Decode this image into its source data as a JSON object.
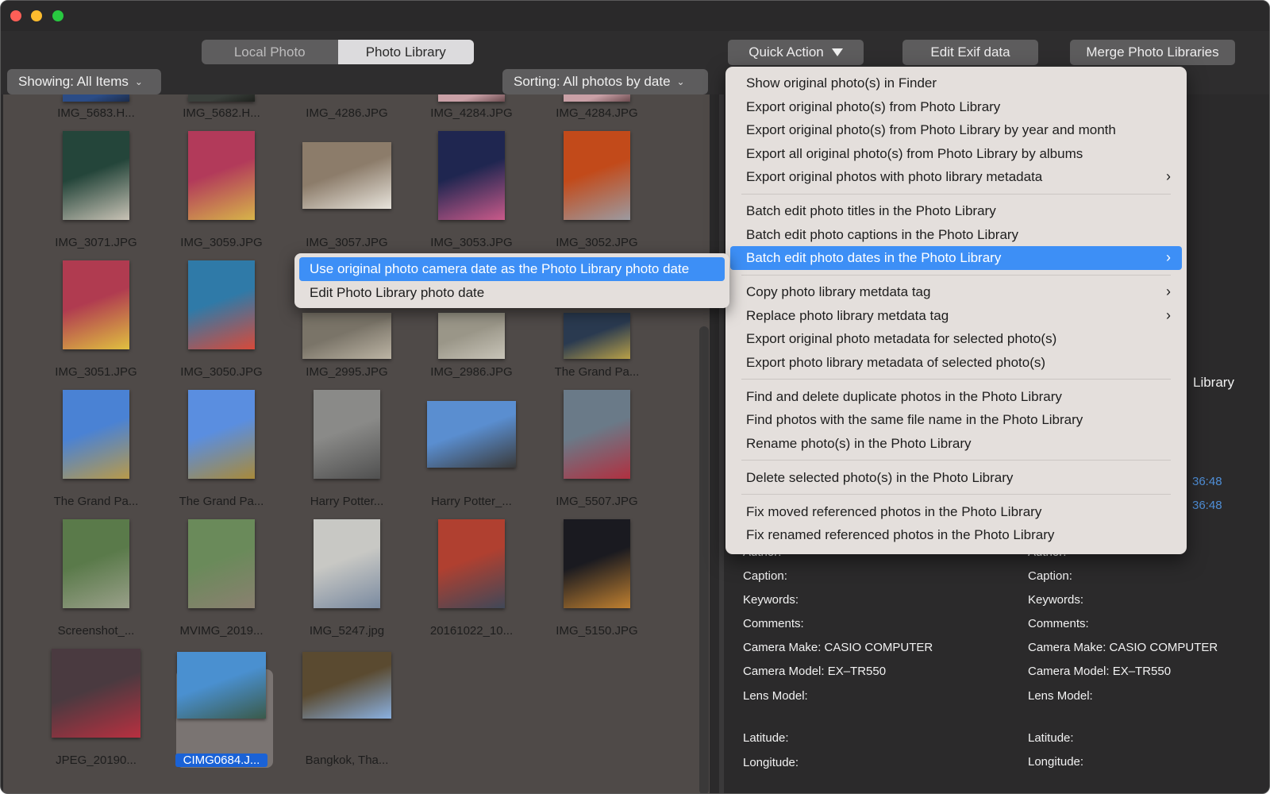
{
  "window": {
    "controls": [
      "close",
      "minimize",
      "zoom"
    ]
  },
  "toolbar": {
    "segments": [
      {
        "label": "Local Photo",
        "active": false
      },
      {
        "label": "Photo Library",
        "active": true
      }
    ],
    "quick_action_label": "Quick Action",
    "edit_exif_label": "Edit Exif data",
    "merge_label": "Merge Photo Libraries",
    "showing_label": "Showing: All Items",
    "sorting_label": "Sorting: All photos by date"
  },
  "photos": [
    {
      "name": "IMG_5683.H..."
    },
    {
      "name": "IMG_5682.H..."
    },
    {
      "name": "IMG_4286.JPG"
    },
    {
      "name": "IMG_4284.JPG"
    },
    {
      "name": "IMG_4284.JPG"
    },
    {
      "name": "IMG_3071.JPG"
    },
    {
      "name": "IMG_3059.JPG"
    },
    {
      "name": "IMG_3057.JPG"
    },
    {
      "name": "IMG_3053.JPG"
    },
    {
      "name": "IMG_3052.JPG"
    },
    {
      "name": "IMG_3051.JPG"
    },
    {
      "name": "IMG_3050.JPG"
    },
    {
      "name": "IMG_2995.JPG"
    },
    {
      "name": "IMG_2986.JPG"
    },
    {
      "name": "The Grand Pa..."
    },
    {
      "name": "The Grand Pa..."
    },
    {
      "name": "The Grand Pa..."
    },
    {
      "name": "Harry Potter..."
    },
    {
      "name": "Harry Potter_..."
    },
    {
      "name": "IMG_5507.JPG"
    },
    {
      "name": "Screenshot_..."
    },
    {
      "name": "MVIMG_2019..."
    },
    {
      "name": "IMG_5247.jpg"
    },
    {
      "name": "20161022_10..."
    },
    {
      "name": "IMG_5150.JPG"
    },
    {
      "name": "JPEG_20190..."
    },
    {
      "name": "CIMG0684.J...",
      "selected": true
    },
    {
      "name": "Bangkok, Tha..."
    }
  ],
  "quick_action_menu": {
    "groups": [
      [
        {
          "label": "Show original photo(s) in Finder"
        },
        {
          "label": "Export original photo(s) from Photo Library"
        },
        {
          "label": "Export original photo(s) from Photo Library by year and month"
        },
        {
          "label": "Export all original photo(s) from Photo Library by albums"
        },
        {
          "label": "Export original photos with photo library metadata",
          "submenu": true
        }
      ],
      [
        {
          "label": "Batch edit photo titles in the Photo Library"
        },
        {
          "label": "Batch edit photo captions in the Photo Library"
        },
        {
          "label": "Batch edit photo dates in the Photo Library",
          "submenu": true,
          "highlighted": true
        }
      ],
      [
        {
          "label": "Copy photo library metdata tag",
          "submenu": true
        },
        {
          "label": "Replace photo library metdata tag",
          "submenu": true
        },
        {
          "label": "Export original photo metadata for selected photo(s)"
        },
        {
          "label": "Export photo library metadata of selected photo(s)"
        }
      ],
      [
        {
          "label": "Find and delete duplicate photos in the Photo Library"
        },
        {
          "label": "Find photos with the same file name in the Photo Library"
        },
        {
          "label": "Rename photo(s) in the Photo Library"
        }
      ],
      [
        {
          "label": "Delete selected photo(s) in the Photo Library"
        }
      ],
      [
        {
          "label": "Fix moved referenced photos in the Photo Library"
        },
        {
          "label": "Fix renamed referenced photos in the Photo Library"
        }
      ]
    ],
    "submenu_chevron": "›"
  },
  "date_submenu": {
    "items": [
      {
        "label": "Use original photo camera date as the Photo Library photo date",
        "highlighted": true
      },
      {
        "label": "Edit Photo Library photo date"
      }
    ]
  },
  "details": {
    "partial_title": "Library",
    "partial_time_1": "36:48",
    "partial_time_2": "36:48",
    "left": {
      "author": "Author:",
      "caption": "Caption:",
      "keywords": "Keywords:",
      "comments": "Comments:",
      "camera_make": "Camera Make: CASIO COMPUTER",
      "camera_model": "Camera Model: EX–TR550",
      "lens_model": "Lens Model:",
      "latitude": "Latitude:",
      "longitude": "Longitude:"
    },
    "right": {
      "author": "Author:",
      "caption": "Caption:",
      "keywords": "Keywords:",
      "comments": "Comments:",
      "camera_make": "Camera Make: CASIO COMPUTER",
      "camera_model": "Camera Model: EX–TR550",
      "lens_model": "Lens Model:",
      "latitude": "Latitude:",
      "longitude": "Longitude:"
    }
  },
  "colors": {
    "accent": "#3d8ff6",
    "selection": "#1a62d6",
    "menu_bg": "#e4dfdc",
    "grid_bg": "#4f4a48"
  }
}
